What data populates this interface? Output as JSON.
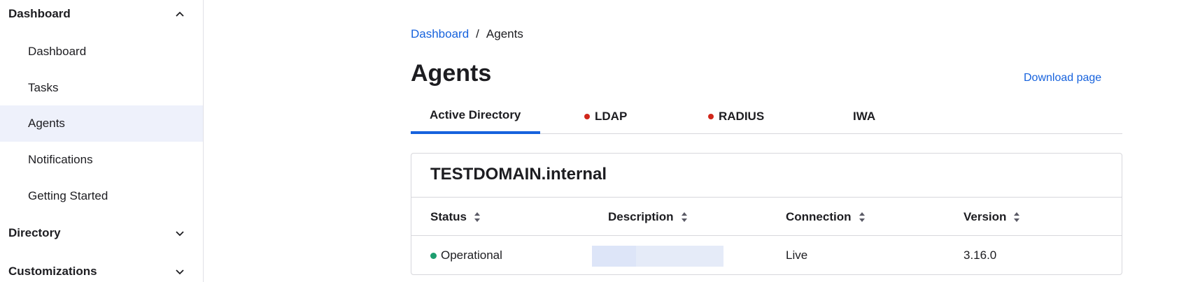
{
  "sidebar": {
    "sections": [
      {
        "label": "Dashboard",
        "expanded": true,
        "icon": "chevron-up-icon"
      },
      {
        "label": "Directory",
        "expanded": false,
        "icon": "chevron-down-icon"
      },
      {
        "label": "Customizations",
        "expanded": false,
        "icon": "chevron-down-icon"
      }
    ],
    "items": [
      {
        "label": "Dashboard"
      },
      {
        "label": "Tasks"
      },
      {
        "label": "Agents",
        "active": true
      },
      {
        "label": "Notifications"
      },
      {
        "label": "Getting Started"
      }
    ]
  },
  "breadcrumb": {
    "link": "Dashboard",
    "separator": "/",
    "current": "Agents"
  },
  "page": {
    "title": "Agents",
    "download_label": "Download page"
  },
  "tabs": [
    {
      "label": "Active Directory",
      "active": true,
      "alert": false
    },
    {
      "label": "LDAP",
      "active": false,
      "alert": true
    },
    {
      "label": "RADIUS",
      "active": false,
      "alert": true
    },
    {
      "label": "IWA",
      "active": false,
      "alert": false
    }
  ],
  "card": {
    "title": "TESTDOMAIN.internal",
    "columns": [
      "Status",
      "Description",
      "Connection",
      "Version"
    ],
    "rows": [
      {
        "status": "Operational",
        "description": "",
        "connection": "Live",
        "version": "3.16.0"
      }
    ]
  },
  "colors": {
    "accent": "#1662dd",
    "alert_dot": "#d1271b",
    "status_ok": "#1d9e6f",
    "active_nav_bg": "#eef1fb"
  }
}
